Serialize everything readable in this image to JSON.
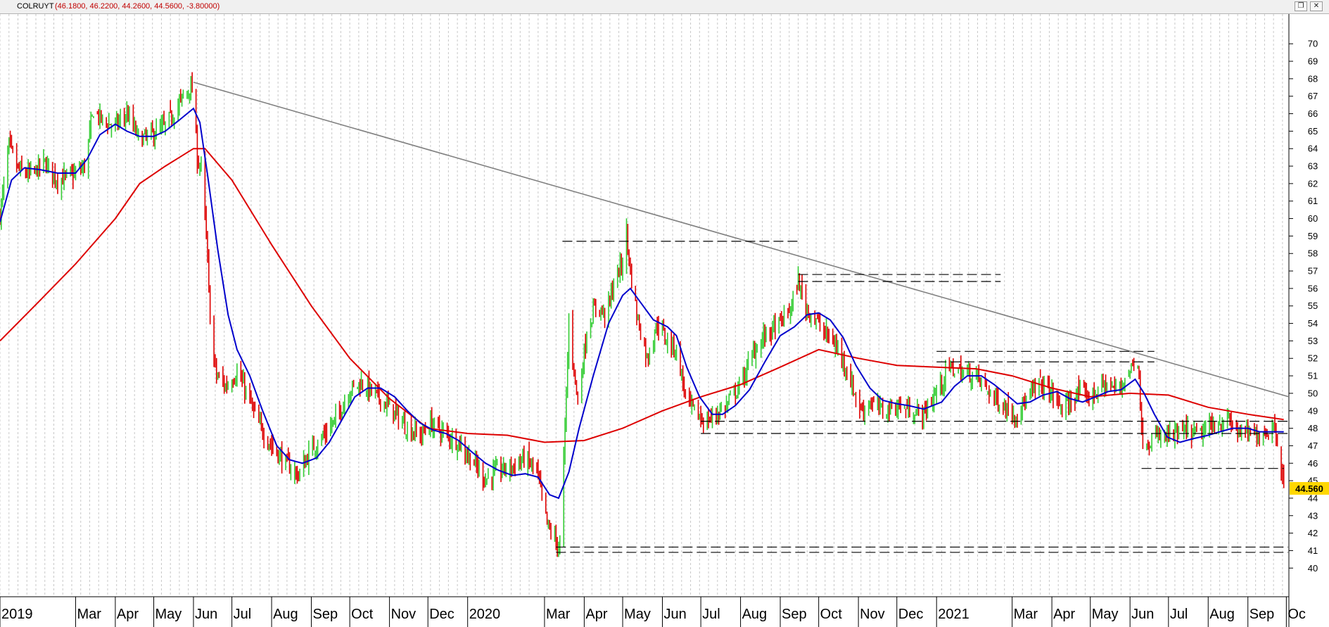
{
  "window": {
    "symbol": "COLRUYT",
    "ohlc_text": "(46.1800, 46.2200, 44.2600, 44.5600, -3.80000)",
    "restore_glyph": "❐",
    "close_glyph": "✕"
  },
  "colors": {
    "up_candle": "#33cc33",
    "down_candle": "#dd0000",
    "ma_short": "#0000cc",
    "ma_long": "#dd0000",
    "trendline": "#808080",
    "support_lines": "#000000",
    "last_price_badge": "#ffd700"
  },
  "chart_data": {
    "type": "candlestick",
    "ticker": "COLRUYT",
    "last_price_label": "44.560",
    "ohlc_last": {
      "open": 46.18,
      "high": 46.22,
      "low": 44.26,
      "close": 44.56,
      "change": -3.8
    },
    "y_axis": {
      "min": 39,
      "max": 70.5,
      "ticks": [
        40,
        41,
        42,
        43,
        44,
        45,
        46,
        47,
        48,
        49,
        50,
        51,
        52,
        53,
        54,
        55,
        56,
        57,
        58,
        59,
        60,
        61,
        62,
        63,
        64,
        65,
        66,
        67,
        68,
        69,
        70
      ]
    },
    "x_axis": {
      "start": "2019-01-01",
      "end": "2021-10-03",
      "labels": [
        {
          "date": "2019-01-01",
          "label": "2019"
        },
        {
          "date": "2019-03-01",
          "label": "Mar"
        },
        {
          "date": "2019-04-01",
          "label": "Apr"
        },
        {
          "date": "2019-05-01",
          "label": "May"
        },
        {
          "date": "2019-06-01",
          "label": "Jun"
        },
        {
          "date": "2019-07-01",
          "label": "Jul"
        },
        {
          "date": "2019-08-01",
          "label": "Aug"
        },
        {
          "date": "2019-09-01",
          "label": "Sep"
        },
        {
          "date": "2019-10-01",
          "label": "Oct"
        },
        {
          "date": "2019-11-01",
          "label": "Nov"
        },
        {
          "date": "2019-12-01",
          "label": "Dec"
        },
        {
          "date": "2020-01-01",
          "label": "2020"
        },
        {
          "date": "2020-03-01",
          "label": "Mar"
        },
        {
          "date": "2020-04-01",
          "label": "Apr"
        },
        {
          "date": "2020-05-01",
          "label": "May"
        },
        {
          "date": "2020-06-01",
          "label": "Jun"
        },
        {
          "date": "2020-07-01",
          "label": "Jul"
        },
        {
          "date": "2020-08-01",
          "label": "Aug"
        },
        {
          "date": "2020-09-01",
          "label": "Sep"
        },
        {
          "date": "2020-10-01",
          "label": "Oct"
        },
        {
          "date": "2020-11-01",
          "label": "Nov"
        },
        {
          "date": "2020-12-01",
          "label": "Dec"
        },
        {
          "date": "2021-01-01",
          "label": "2021"
        },
        {
          "date": "2021-03-01",
          "label": "Mar"
        },
        {
          "date": "2021-04-01",
          "label": "Apr"
        },
        {
          "date": "2021-05-01",
          "label": "May"
        },
        {
          "date": "2021-06-01",
          "label": "Jun"
        },
        {
          "date": "2021-07-01",
          "label": "Jul"
        },
        {
          "date": "2021-08-01",
          "label": "Aug"
        },
        {
          "date": "2021-09-01",
          "label": "Sep"
        },
        {
          "date": "2021-10-01",
          "label": "Oc"
        }
      ],
      "grid": "vertical-dashed-weekly"
    },
    "price_path": [
      [
        "2019-01-01",
        60.2
      ],
      [
        "2019-01-08",
        64.2
      ],
      [
        "2019-01-15",
        62.8
      ],
      [
        "2019-01-25",
        62.5
      ],
      [
        "2019-02-05",
        63.2
      ],
      [
        "2019-02-15",
        62.2
      ],
      [
        "2019-02-27",
        62.5
      ],
      [
        "2019-03-08",
        63.0
      ],
      [
        "2019-03-15",
        66.2
      ],
      [
        "2019-03-22",
        65.6
      ],
      [
        "2019-04-01",
        65.3
      ],
      [
        "2019-04-10",
        66.0
      ],
      [
        "2019-04-20",
        64.5
      ],
      [
        "2019-04-30",
        64.8
      ],
      [
        "2019-05-10",
        65.3
      ],
      [
        "2019-05-20",
        66.5
      ],
      [
        "2019-05-29",
        67.5
      ],
      [
        "2019-06-01",
        67.2
      ],
      [
        "2019-06-04",
        63.4
      ],
      [
        "2019-06-08",
        62.8
      ],
      [
        "2019-06-12",
        57.5
      ],
      [
        "2019-06-15",
        52.8
      ],
      [
        "2019-06-19",
        51.0
      ],
      [
        "2019-06-26",
        50.4
      ],
      [
        "2019-07-05",
        51.2
      ],
      [
        "2019-07-12",
        50.1
      ],
      [
        "2019-07-22",
        48.2
      ],
      [
        "2019-08-01",
        47.0
      ],
      [
        "2019-08-12",
        46.0
      ],
      [
        "2019-08-22",
        45.3
      ],
      [
        "2019-09-01",
        46.8
      ],
      [
        "2019-09-10",
        47.5
      ],
      [
        "2019-09-20",
        48.5
      ],
      [
        "2019-10-01",
        50.2
      ],
      [
        "2019-10-10",
        50.6
      ],
      [
        "2019-10-20",
        50.0
      ],
      [
        "2019-11-01",
        49.2
      ],
      [
        "2019-11-15",
        48.0
      ],
      [
        "2019-11-26",
        47.6
      ],
      [
        "2019-12-03",
        48.3
      ],
      [
        "2019-12-12",
        47.8
      ],
      [
        "2019-12-25",
        47.2
      ],
      [
        "2020-01-06",
        46.0
      ],
      [
        "2020-01-15",
        45.1
      ],
      [
        "2020-01-25",
        45.6
      ],
      [
        "2020-02-05",
        45.8
      ],
      [
        "2020-02-15",
        46.3
      ],
      [
        "2020-02-24",
        45.5
      ],
      [
        "2020-03-03",
        42.5
      ],
      [
        "2020-03-10",
        41.5
      ],
      [
        "2020-03-13",
        41.2
      ],
      [
        "2020-03-17",
        48.0
      ],
      [
        "2020-03-20",
        54.0
      ],
      [
        "2020-03-27",
        49.5
      ],
      [
        "2020-04-03",
        53.5
      ],
      [
        "2020-04-10",
        55.0
      ],
      [
        "2020-04-18",
        54.5
      ],
      [
        "2020-04-25",
        56.5
      ],
      [
        "2020-05-01",
        57.5
      ],
      [
        "2020-05-04",
        59.2
      ],
      [
        "2020-05-07",
        57.0
      ],
      [
        "2020-05-12",
        54.5
      ],
      [
        "2020-05-20",
        52.0
      ],
      [
        "2020-05-28",
        54.0
      ],
      [
        "2020-06-05",
        53.0
      ],
      [
        "2020-06-12",
        52.5
      ],
      [
        "2020-06-20",
        49.5
      ],
      [
        "2020-06-28",
        48.8
      ],
      [
        "2020-07-05",
        48.3
      ],
      [
        "2020-07-12",
        48.8
      ],
      [
        "2020-07-20",
        49.2
      ],
      [
        "2020-08-01",
        50.5
      ],
      [
        "2020-08-12",
        52.5
      ],
      [
        "2020-08-20",
        53.3
      ],
      [
        "2020-09-01",
        54.0
      ],
      [
        "2020-09-10",
        55.0
      ],
      [
        "2020-09-15",
        56.5
      ],
      [
        "2020-09-20",
        55.0
      ],
      [
        "2020-09-28",
        54.3
      ],
      [
        "2020-10-05",
        53.5
      ],
      [
        "2020-10-12",
        53.0
      ],
      [
        "2020-10-20",
        52.0
      ],
      [
        "2020-10-28",
        50.2
      ],
      [
        "2020-11-03",
        49.0
      ],
      [
        "2020-11-10",
        49.5
      ],
      [
        "2020-11-20",
        49.0
      ],
      [
        "2020-12-01",
        49.3
      ],
      [
        "2020-12-12",
        49.0
      ],
      [
        "2020-12-22",
        48.8
      ],
      [
        "2021-01-04",
        50.5
      ],
      [
        "2021-01-12",
        51.5
      ],
      [
        "2021-01-20",
        51.2
      ],
      [
        "2021-02-01",
        51.0
      ],
      [
        "2021-02-12",
        50.0
      ],
      [
        "2021-02-22",
        49.3
      ],
      [
        "2021-03-03",
        48.8
      ],
      [
        "2021-03-12",
        49.5
      ],
      [
        "2021-03-22",
        50.6
      ],
      [
        "2021-04-01",
        50.0
      ],
      [
        "2021-04-10",
        49.0
      ],
      [
        "2021-04-20",
        50.0
      ],
      [
        "2021-05-01",
        49.8
      ],
      [
        "2021-05-12",
        50.5
      ],
      [
        "2021-05-22",
        50.2
      ],
      [
        "2021-06-01",
        51.3
      ],
      [
        "2021-06-05",
        52.0
      ],
      [
        "2021-06-08",
        51.5
      ],
      [
        "2021-06-10",
        47.5
      ],
      [
        "2021-06-14",
        47.2
      ],
      [
        "2021-06-25",
        47.5
      ],
      [
        "2021-07-05",
        47.6
      ],
      [
        "2021-07-15",
        47.8
      ],
      [
        "2021-07-25",
        47.6
      ],
      [
        "2021-08-05",
        48.2
      ],
      [
        "2021-08-15",
        48.5
      ],
      [
        "2021-08-25",
        47.8
      ],
      [
        "2021-09-05",
        47.6
      ],
      [
        "2021-09-15",
        47.8
      ],
      [
        "2021-09-22",
        48.2
      ],
      [
        "2021-09-27",
        45.8
      ],
      [
        "2021-09-29",
        44.56
      ]
    ],
    "ma_short": [
      [
        "2019-01-01",
        59.8
      ],
      [
        "2019-01-10",
        62.2
      ],
      [
        "2019-01-20",
        62.9
      ],
      [
        "2019-02-01",
        62.8
      ],
      [
        "2019-02-15",
        62.6
      ],
      [
        "2019-03-01",
        62.6
      ],
      [
        "2019-03-10",
        63.4
      ],
      [
        "2019-03-20",
        64.8
      ],
      [
        "2019-04-01",
        65.4
      ],
      [
        "2019-04-10",
        65.0
      ],
      [
        "2019-04-20",
        64.7
      ],
      [
        "2019-05-01",
        64.7
      ],
      [
        "2019-05-10",
        65.0
      ],
      [
        "2019-05-22",
        65.7
      ],
      [
        "2019-06-01",
        66.3
      ],
      [
        "2019-06-06",
        65.5
      ],
      [
        "2019-06-12",
        62.5
      ],
      [
        "2019-06-20",
        58.2
      ],
      [
        "2019-06-28",
        54.5
      ],
      [
        "2019-07-05",
        52.5
      ],
      [
        "2019-07-15",
        51.0
      ],
      [
        "2019-07-25",
        49.0
      ],
      [
        "2019-08-05",
        47.0
      ],
      [
        "2019-08-15",
        46.2
      ],
      [
        "2019-08-25",
        46.0
      ],
      [
        "2019-09-05",
        46.3
      ],
      [
        "2019-09-15",
        47.2
      ],
      [
        "2019-09-25",
        48.5
      ],
      [
        "2019-10-05",
        49.8
      ],
      [
        "2019-10-15",
        50.3
      ],
      [
        "2019-10-25",
        50.3
      ],
      [
        "2019-11-05",
        49.8
      ],
      [
        "2019-11-15",
        49.0
      ],
      [
        "2019-11-25",
        48.3
      ],
      [
        "2019-12-05",
        47.9
      ],
      [
        "2019-12-15",
        47.7
      ],
      [
        "2019-12-25",
        47.3
      ],
      [
        "2020-01-05",
        46.6
      ],
      [
        "2020-01-15",
        46.0
      ],
      [
        "2020-01-25",
        45.6
      ],
      [
        "2020-02-05",
        45.3
      ],
      [
        "2020-02-15",
        45.4
      ],
      [
        "2020-02-25",
        45.2
      ],
      [
        "2020-03-05",
        44.2
      ],
      [
        "2020-03-12",
        44.0
      ],
      [
        "2020-03-20",
        45.5
      ],
      [
        "2020-03-28",
        48.0
      ],
      [
        "2020-04-08",
        51.0
      ],
      [
        "2020-04-20",
        54.0
      ],
      [
        "2020-05-01",
        55.6
      ],
      [
        "2020-05-07",
        56.0
      ],
      [
        "2020-05-15",
        55.2
      ],
      [
        "2020-05-25",
        54.2
      ],
      [
        "2020-06-05",
        53.8
      ],
      [
        "2020-06-12",
        53.3
      ],
      [
        "2020-06-20",
        51.5
      ],
      [
        "2020-06-30",
        49.8
      ],
      [
        "2020-07-10",
        48.8
      ],
      [
        "2020-07-18",
        48.8
      ],
      [
        "2020-07-28",
        49.3
      ],
      [
        "2020-08-08",
        50.2
      ],
      [
        "2020-08-20",
        51.8
      ],
      [
        "2020-09-01",
        53.3
      ],
      [
        "2020-09-12",
        53.8
      ],
      [
        "2020-09-22",
        54.5
      ],
      [
        "2020-10-01",
        54.6
      ],
      [
        "2020-10-10",
        54.2
      ],
      [
        "2020-10-20",
        53.2
      ],
      [
        "2020-10-30",
        51.6
      ],
      [
        "2020-11-10",
        50.3
      ],
      [
        "2020-11-20",
        49.6
      ],
      [
        "2020-12-01",
        49.4
      ],
      [
        "2020-12-10",
        49.3
      ],
      [
        "2020-12-22",
        49.1
      ],
      [
        "2021-01-05",
        49.5
      ],
      [
        "2021-01-15",
        50.4
      ],
      [
        "2021-01-25",
        51.0
      ],
      [
        "2021-02-05",
        51.0
      ],
      [
        "2021-02-15",
        50.5
      ],
      [
        "2021-02-25",
        49.9
      ],
      [
        "2021-03-05",
        49.4
      ],
      [
        "2021-03-15",
        49.5
      ],
      [
        "2021-03-25",
        49.9
      ],
      [
        "2021-04-05",
        50.1
      ],
      [
        "2021-04-15",
        49.7
      ],
      [
        "2021-04-25",
        49.5
      ],
      [
        "2021-05-05",
        49.8
      ],
      [
        "2021-05-15",
        50.1
      ],
      [
        "2021-05-25",
        50.2
      ],
      [
        "2021-06-05",
        50.8
      ],
      [
        "2021-06-12",
        50.0
      ],
      [
        "2021-06-20",
        48.8
      ],
      [
        "2021-06-30",
        47.5
      ],
      [
        "2021-07-10",
        47.2
      ],
      [
        "2021-07-20",
        47.4
      ],
      [
        "2021-08-01",
        47.6
      ],
      [
        "2021-08-10",
        47.8
      ],
      [
        "2021-08-20",
        48.0
      ],
      [
        "2021-09-01",
        48.0
      ],
      [
        "2021-09-10",
        47.8
      ],
      [
        "2021-09-20",
        47.8
      ],
      [
        "2021-09-29",
        47.8
      ]
    ],
    "ma_long": [
      [
        "2019-01-01",
        53.0
      ],
      [
        "2019-02-01",
        55.3
      ],
      [
        "2019-03-01",
        57.4
      ],
      [
        "2019-04-01",
        60.0
      ],
      [
        "2019-04-20",
        62.0
      ],
      [
        "2019-05-10",
        63.0
      ],
      [
        "2019-06-01",
        64.0
      ],
      [
        "2019-06-10",
        64.0
      ],
      [
        "2019-07-01",
        62.2
      ],
      [
        "2019-08-01",
        58.5
      ],
      [
        "2019-09-01",
        55.0
      ],
      [
        "2019-10-01",
        52.0
      ],
      [
        "2019-11-01",
        49.7
      ],
      [
        "2019-12-01",
        48.0
      ],
      [
        "2020-01-01",
        47.7
      ],
      [
        "2020-02-01",
        47.6
      ],
      [
        "2020-03-01",
        47.2
      ],
      [
        "2020-04-01",
        47.3
      ],
      [
        "2020-05-01",
        48.0
      ],
      [
        "2020-06-01",
        49.0
      ],
      [
        "2020-07-01",
        49.8
      ],
      [
        "2020-08-01",
        50.5
      ],
      [
        "2020-09-01",
        51.5
      ],
      [
        "2020-10-01",
        52.5
      ],
      [
        "2020-11-01",
        52.0
      ],
      [
        "2020-12-01",
        51.6
      ],
      [
        "2021-01-01",
        51.5
      ],
      [
        "2021-02-01",
        51.4
      ],
      [
        "2021-03-01",
        51.0
      ],
      [
        "2021-04-01",
        50.3
      ],
      [
        "2021-05-01",
        49.8
      ],
      [
        "2021-06-01",
        50.0
      ],
      [
        "2021-07-01",
        49.9
      ],
      [
        "2021-08-01",
        49.2
      ],
      [
        "2021-09-01",
        48.8
      ],
      [
        "2021-09-29",
        48.5
      ]
    ],
    "trendline": [
      [
        "2019-06-01",
        67.8
      ],
      [
        "2021-10-03",
        49.8
      ]
    ],
    "dashed_levels": [
      {
        "start": "2020-03-15",
        "end": "2020-09-15",
        "value": 58.7
      },
      {
        "start": "2020-09-15",
        "end": "2021-02-20",
        "value": 56.8
      },
      {
        "start": "2020-09-15",
        "end": "2021-02-20",
        "value": 56.4
      },
      {
        "start": "2021-01-01",
        "end": "2021-06-20",
        "value": 52.4
      },
      {
        "start": "2021-01-01",
        "end": "2021-06-20",
        "value": 51.8
      },
      {
        "start": "2020-07-01",
        "end": "2021-10-03",
        "value": 48.4
      },
      {
        "start": "2020-07-01",
        "end": "2021-10-03",
        "value": 47.7
      },
      {
        "start": "2021-06-10",
        "end": "2021-09-29",
        "value": 45.7
      },
      {
        "start": "2020-03-10",
        "end": "2021-10-03",
        "value": 41.2
      },
      {
        "start": "2020-03-10",
        "end": "2021-10-03",
        "value": 40.9
      }
    ],
    "series": [
      {
        "type": "candles",
        "source": "price_path"
      },
      {
        "type": "line",
        "source": "ma_short"
      },
      {
        "type": "line",
        "source": "ma_long"
      }
    ]
  }
}
